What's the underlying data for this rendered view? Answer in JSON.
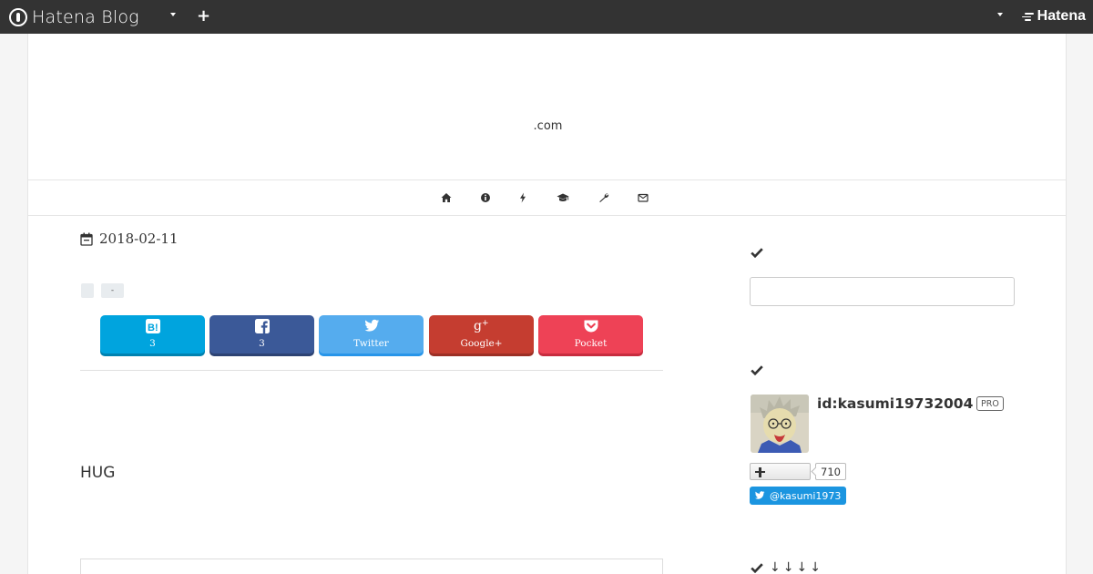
{
  "global_header": {
    "logo_text": "Hatena Blog",
    "hatena_text": "Hatena"
  },
  "blog": {
    "title": ".com"
  },
  "nav": {
    "items": [
      {
        "icon": "home-icon"
      },
      {
        "icon": "info-icon"
      },
      {
        "icon": "bolt-icon"
      },
      {
        "icon": "graduation-cap-icon"
      },
      {
        "icon": "wrench-icon"
      },
      {
        "icon": "envelope-icon"
      }
    ]
  },
  "entry": {
    "date": "2018-02-11",
    "categories": [
      "",
      "-"
    ],
    "share": {
      "hatena_count": "3",
      "facebook_count": "3",
      "twitter_label": "Twitter",
      "google_label": "Google+",
      "pocket_label": "Pocket"
    },
    "body_text": "HUG"
  },
  "sidebar": {
    "search_placeholder": "",
    "profile": {
      "id": "id:kasumi19732004",
      "badge": "PRO",
      "subscriber_count": "710",
      "twitter_handle": "@kasumi1973"
    },
    "archive_arrows": "↓↓↓↓"
  },
  "colors": {
    "header_bg": "#333333",
    "hatena_bookmark": "#00a4de",
    "facebook": "#3b5998",
    "twitter": "#55acee",
    "google_plus": "#c53d30",
    "pocket": "#ee4256",
    "twitter_follow": "#1b95e0"
  }
}
